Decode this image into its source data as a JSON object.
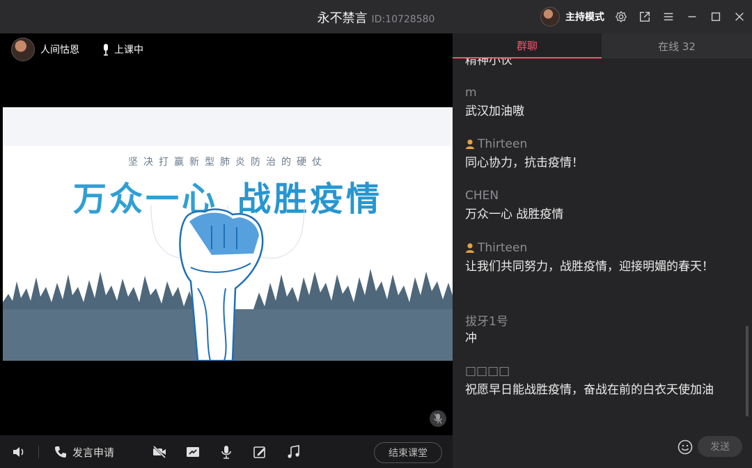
{
  "window": {
    "title": "永不禁言",
    "room_id": "ID:10728580",
    "mode_label": "主持模式"
  },
  "presenter": {
    "name": "人间怙恩",
    "status": "上课中"
  },
  "slide": {
    "subtitle": "坚决打赢新型肺炎防治的硬仗",
    "headline_left": "万众一心",
    "headline_right": "战胜疫情"
  },
  "toolbar": {
    "apply_label": "发言申请",
    "end_class_label": "结束课堂"
  },
  "tabs": [
    {
      "label": "群聊"
    },
    {
      "label": "在线 32"
    }
  ],
  "chat": {
    "cut_text": "精神小伙",
    "messages": [
      {
        "sender": "m",
        "text": "武汉加油嗷",
        "is_teacher": false
      },
      {
        "sender": "Thirteen",
        "text": "同心协力，抗击疫情！",
        "is_teacher": true
      },
      {
        "sender": "CHEN",
        "text": "万众一心 战胜疫情",
        "is_teacher": false
      },
      {
        "sender": "Thirteen",
        "text": "让我们共同努力，战胜疫情，迎接明媚的春天！",
        "is_teacher": true
      },
      {
        "sender": "拔牙1号",
        "text": "冲",
        "is_teacher": false
      },
      {
        "sender": "□□□□",
        "text": "祝愿早日能战胜疫情，奋战在前的白衣天使加油",
        "is_teacher": false
      }
    ],
    "send_label": "发送"
  },
  "colors": {
    "accent": "#f0566e",
    "headline_blue": "#2f9fd4",
    "teacher_badge": "#e8a040"
  },
  "icons": [
    "avatar",
    "gear-icon",
    "popout-icon",
    "menu-icon",
    "minimize-icon",
    "maximize-icon",
    "close-icon",
    "microphone-icon",
    "volume-icon",
    "phone-icon",
    "camera-off-icon",
    "screen-share-icon",
    "mic-icon",
    "edit-icon",
    "music-icon",
    "emoji-icon"
  ]
}
